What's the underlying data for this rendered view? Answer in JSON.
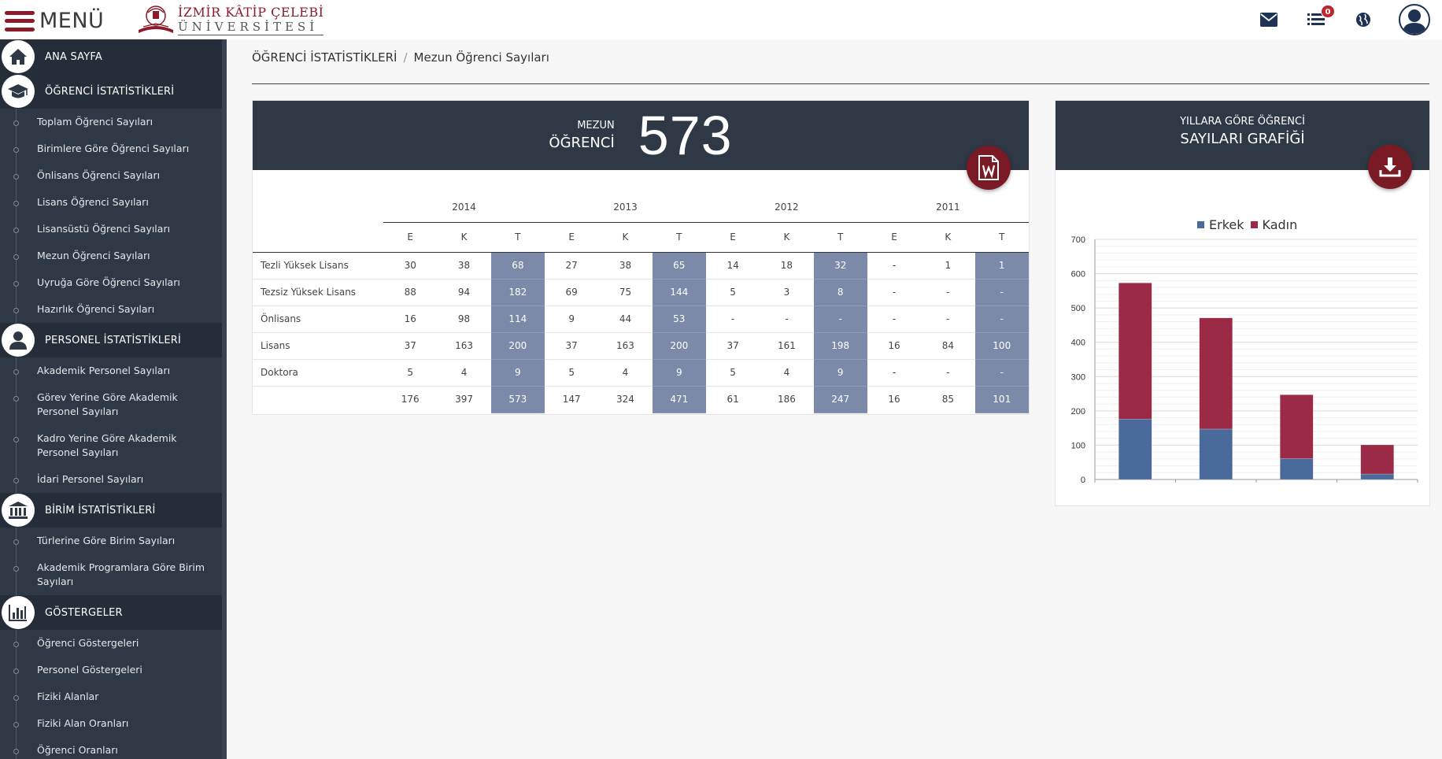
{
  "header": {
    "menu_label": "MENÜ",
    "logo_line1": "İZMİR KÂTİP ÇELEBİ",
    "logo_line2": "ÜNİVERSİTESİ",
    "notifications_count": "0"
  },
  "sidebar": {
    "sections": [
      {
        "label": "ANA SAYFA",
        "icon": "home-icon",
        "items": []
      },
      {
        "label": "ÖĞRENCİ İSTATİSTİKLERİ",
        "icon": "graduation-cap-icon",
        "items": [
          "Toplam Öğrenci Sayıları",
          "Birimlere Göre Öğrenci Sayıları",
          "Önlisans Öğrenci Sayıları",
          "Lisans Öğrenci Sayıları",
          "Lisansüstü Öğrenci Sayıları",
          "Mezun Öğrenci Sayıları",
          "Uyruğa Göre Öğrenci Sayıları",
          "Hazırlık Öğrenci Sayıları"
        ]
      },
      {
        "label": "PERSONEL İSTATİSTİKLERİ",
        "icon": "user-icon",
        "items": [
          "Akademik Personel Sayıları",
          "Görev Yerine Göre Akademik Personel Sayıları",
          "Kadro Yerine Göre Akademik Personel Sayıları",
          "İdari Personel Sayıları"
        ]
      },
      {
        "label": "BİRİM İSTATİSTİKLERİ",
        "icon": "institution-icon",
        "items": [
          "Türlerine Göre Birim Sayıları",
          "Akademik Programlara Göre Birim Sayıları"
        ]
      },
      {
        "label": "GÖSTERGELER",
        "icon": "bar-chart-icon",
        "items": [
          "Öğrenci Göstergeleri",
          "Personel Göstergeleri",
          "Fiziki Alanlar",
          "Fiziki Alan Oranları",
          "Öğrenci Oranları"
        ]
      }
    ]
  },
  "breadcrumb": {
    "root": "ÖĞRENCİ İSTATİSTİKLERİ",
    "sep": "/",
    "current": "Mezun Öğrenci Sayıları"
  },
  "stat_panel": {
    "label_small": "MEZUN",
    "label_big": "ÖĞRENCİ",
    "value": "573"
  },
  "table": {
    "years": [
      "2014",
      "2013",
      "2012",
      "2011"
    ],
    "sub_headers": [
      "E",
      "K",
      "T"
    ],
    "rows": [
      {
        "name": "Tezli Yüksek Lisans",
        "cells": [
          "30",
          "38",
          "68",
          "27",
          "38",
          "65",
          "14",
          "18",
          "32",
          "-",
          "1",
          "1"
        ]
      },
      {
        "name": "Tezsiz Yüksek Lisans",
        "cells": [
          "88",
          "94",
          "182",
          "69",
          "75",
          "144",
          "5",
          "3",
          "8",
          "-",
          "-",
          "-"
        ]
      },
      {
        "name": "Önlisans",
        "cells": [
          "16",
          "98",
          "114",
          "9",
          "44",
          "53",
          "-",
          "-",
          "-",
          "-",
          "-",
          "-"
        ]
      },
      {
        "name": "Lisans",
        "cells": [
          "37",
          "163",
          "200",
          "37",
          "163",
          "200",
          "37",
          "161",
          "198",
          "16",
          "84",
          "100"
        ]
      },
      {
        "name": "Doktora",
        "cells": [
          "5",
          "4",
          "9",
          "5",
          "4",
          "9",
          "5",
          "4",
          "9",
          "-",
          "-",
          "-"
        ]
      }
    ],
    "totals": [
      "176",
      "397",
      "573",
      "147",
      "324",
      "471",
      "61",
      "186",
      "247",
      "16",
      "85",
      "101"
    ]
  },
  "chart_panel": {
    "title_small": "YILLARA GÖRE ÖĞRENCİ",
    "title_big": "SAYILARI GRAFİĞİ"
  },
  "chart_data": {
    "type": "bar",
    "stacked": true,
    "categories": [
      "2014",
      "2013",
      "2012",
      "2011"
    ],
    "series": [
      {
        "name": "Erkek",
        "values": [
          176,
          147,
          61,
          16
        ],
        "color": "#4a6a9c"
      },
      {
        "name": "Kadın",
        "values": [
          397,
          324,
          186,
          85
        ],
        "color": "#9a2a45"
      }
    ],
    "ylim": [
      0,
      700
    ],
    "yticks": [
      0,
      100,
      200,
      300,
      400,
      500,
      600,
      700
    ],
    "show_xtick_labels": false,
    "legend": "top-center",
    "grid": true
  },
  "colors": {
    "sidebar_bg": "#2f3845",
    "accent": "#8b1a2b",
    "total_cell": "#7b8aa8"
  }
}
